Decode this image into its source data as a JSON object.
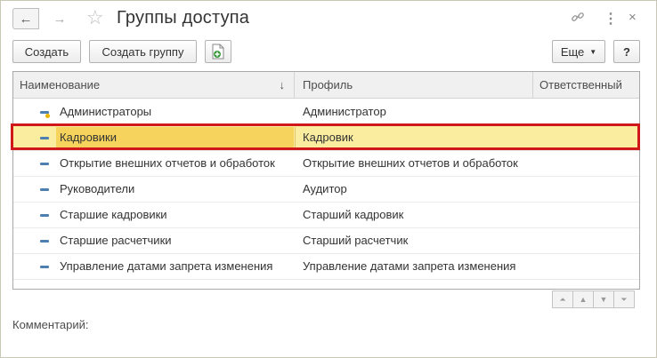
{
  "window": {
    "title": "Группы доступа",
    "back_glyph": "←",
    "forward_glyph": "→",
    "star_glyph": "☆",
    "link_glyph": "🔗",
    "more_glyph": "⋮",
    "close_glyph": "×"
  },
  "toolbar": {
    "create_label": "Создать",
    "create_group_label": "Создать группу",
    "more_label": "Еще",
    "more_caret": "▼",
    "help_label": "?"
  },
  "table": {
    "columns": [
      "Наименование",
      "Профиль",
      "Ответственный"
    ],
    "sort_glyph": "↓",
    "rows": [
      {
        "name": "Администраторы",
        "profile": "Администратор",
        "responsible": ""
      },
      {
        "name": "Кадровики",
        "profile": "Кадровик",
        "responsible": ""
      },
      {
        "name": "Открытие внешних отчетов и обработок",
        "profile": "Открытие внешних отчетов и обработок",
        "responsible": ""
      },
      {
        "name": "Руководители",
        "profile": "Аудитор",
        "responsible": ""
      },
      {
        "name": "Старшие кадровики",
        "profile": "Старший кадровик",
        "responsible": ""
      },
      {
        "name": "Старшие расчетчики",
        "profile": "Старший расчетчик",
        "responsible": ""
      },
      {
        "name": "Управление датами запрета изменения",
        "profile": "Управление датами запрета изменения",
        "responsible": ""
      }
    ]
  },
  "scroll": {
    "top_glyph": "⏶",
    "up_glyph": "▲",
    "down_glyph": "▼",
    "bottom_glyph": "⏷"
  },
  "comment": {
    "label": "Комментарий:"
  },
  "colors": {
    "selection": "#faeda0",
    "selection_cell": "#f5d35c",
    "highlight_border": "#d0181a",
    "row_icon": "#4d7fb0"
  }
}
